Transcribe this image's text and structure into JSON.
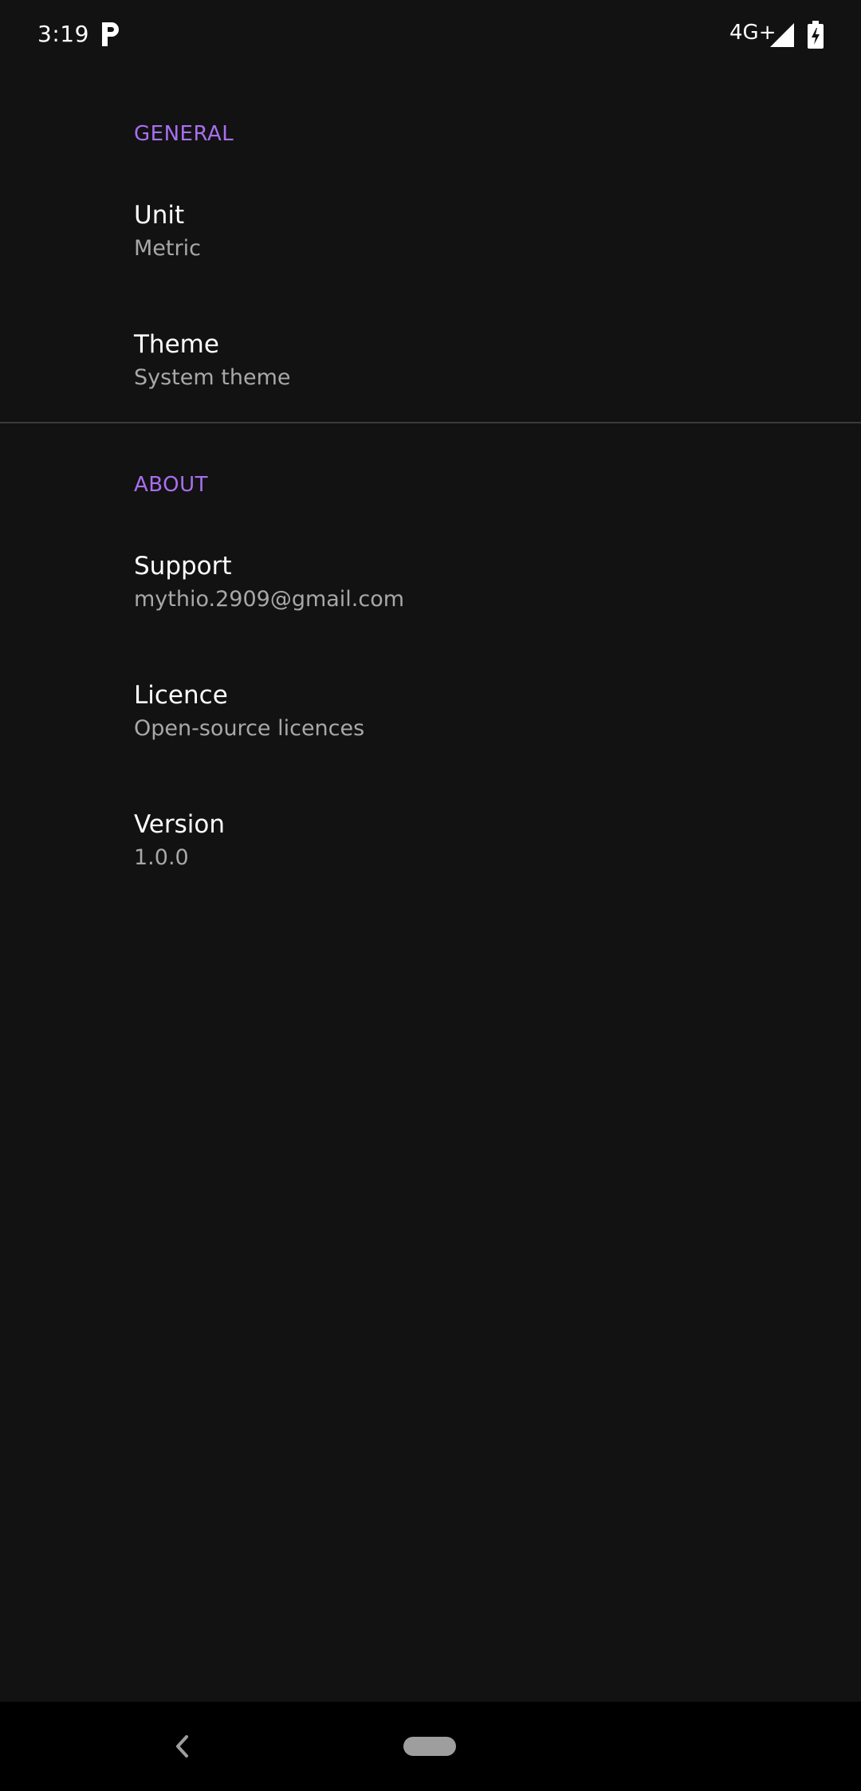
{
  "status_bar": {
    "time": "3:19",
    "network": "4G+",
    "app_icon": "p-app-icon",
    "signal_icon": "signal-icon",
    "battery_icon": "battery-charging-icon"
  },
  "sections": {
    "general": {
      "header": "GENERAL",
      "unit": {
        "title": "Unit",
        "summary": "Metric"
      },
      "theme": {
        "title": "Theme",
        "summary": "System theme"
      }
    },
    "about": {
      "header": "ABOUT",
      "support": {
        "title": "Support",
        "summary": "mythio.2909@gmail.com"
      },
      "licence": {
        "title": "Licence",
        "summary": "Open-source licences"
      },
      "version": {
        "title": "Version",
        "summary": "1.0.0"
      }
    }
  },
  "nav_bar": {
    "back_icon": "back-chevron-icon",
    "home_icon": "home-pill-icon"
  },
  "colors": {
    "background": "#121212",
    "accent": "#a86ff0",
    "title_text": "#ffffff",
    "summary_text": "#a8a8a8",
    "nav_background": "#000000"
  }
}
